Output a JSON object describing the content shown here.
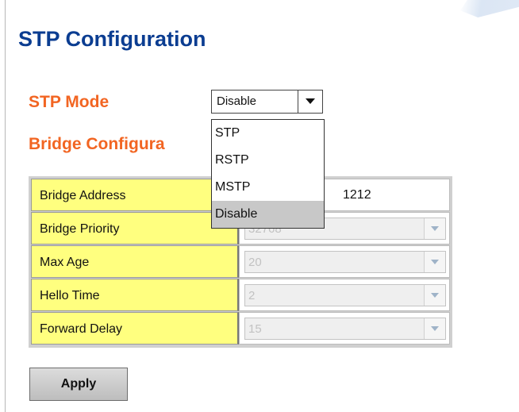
{
  "page": {
    "title": "STP Configuration"
  },
  "stp_mode": {
    "label": "STP Mode",
    "selected": "Disable",
    "options": [
      "STP",
      "RSTP",
      "MSTP",
      "Disable"
    ],
    "dropdown_open": true
  },
  "bridge": {
    "heading": "Bridge Configura",
    "rows": [
      {
        "label": "Bridge Address",
        "value": "1212",
        "type": "text"
      },
      {
        "label": "Bridge Priority",
        "value": "32768",
        "type": "select-disabled"
      },
      {
        "label": "Max Age",
        "value": "20",
        "type": "select-disabled"
      },
      {
        "label": "Hello Time",
        "value": "2",
        "type": "select-disabled"
      },
      {
        "label": "Forward Delay",
        "value": "15",
        "type": "select-disabled"
      }
    ]
  },
  "actions": {
    "apply_label": "Apply"
  },
  "colors": {
    "title": "#0b3d91",
    "section_label": "#f26522",
    "row_label_bg": "#ffff7f",
    "option_highlight": "#c8c8c8"
  },
  "icons": {
    "dropdown_arrow": "chevron-down-icon"
  }
}
